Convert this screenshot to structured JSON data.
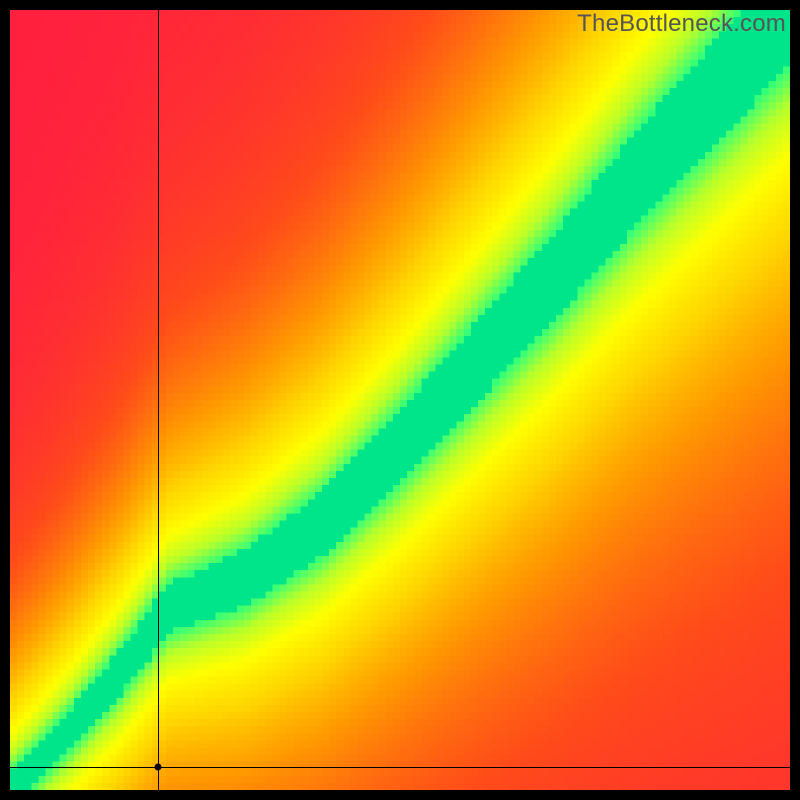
{
  "watermark": "TheBottleneck.com",
  "chart_data": {
    "type": "heatmap",
    "title": "",
    "xlabel": "",
    "ylabel": "",
    "xlim": [
      0,
      100
    ],
    "ylim": [
      0,
      100
    ],
    "grid": false,
    "legend": false,
    "description": "Bottleneck compatibility heatmap. Green diagonal band indicates balanced pairing; red/orange regions indicate bottleneck.",
    "colormap": {
      "0.00": "#ff1f3f",
      "0.20": "#ff4a1a",
      "0.40": "#ff9a00",
      "0.55": "#ffd400",
      "0.70": "#ffff00",
      "0.82": "#b8ff2a",
      "0.92": "#36ff77",
      "1.00": "#00e58a"
    },
    "optimal_curve_points": [
      {
        "x": 0,
        "y": 0
      },
      {
        "x": 7,
        "y": 7
      },
      {
        "x": 14,
        "y": 15
      },
      {
        "x": 20,
        "y": 23
      },
      {
        "x": 30,
        "y": 27
      },
      {
        "x": 40,
        "y": 34
      },
      {
        "x": 50,
        "y": 44
      },
      {
        "x": 60,
        "y": 55
      },
      {
        "x": 70,
        "y": 66
      },
      {
        "x": 80,
        "y": 78
      },
      {
        "x": 90,
        "y": 89
      },
      {
        "x": 100,
        "y": 100
      }
    ],
    "band_half_width": 5.5,
    "crosshair": {
      "x": 19,
      "y": 3
    },
    "marker": {
      "x": 19,
      "y": 3
    }
  }
}
